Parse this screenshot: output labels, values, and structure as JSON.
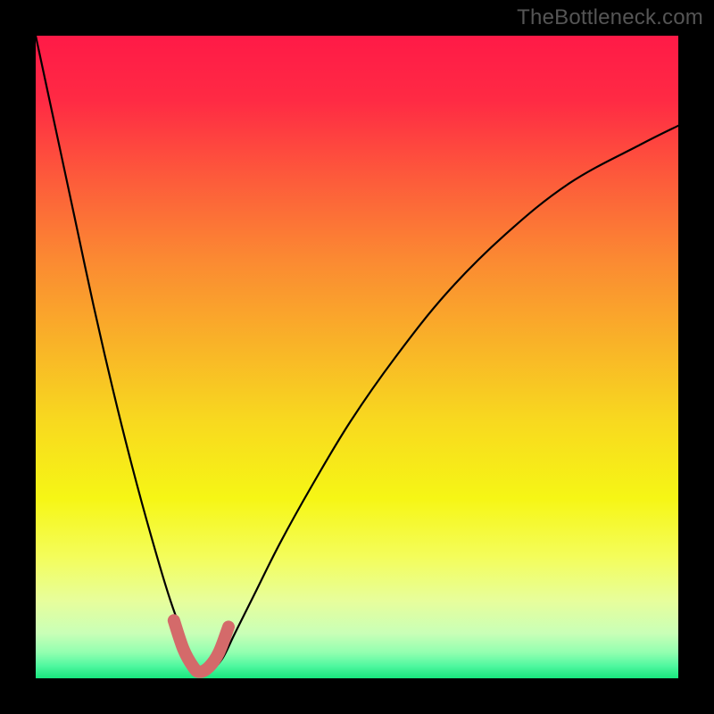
{
  "watermark": "TheBottleneck.com",
  "gradient_stops": [
    {
      "offset": 0,
      "color": "#ff1a47"
    },
    {
      "offset": 10,
      "color": "#ff2a44"
    },
    {
      "offset": 22,
      "color": "#fd5a3b"
    },
    {
      "offset": 35,
      "color": "#fb8a32"
    },
    {
      "offset": 48,
      "color": "#f9b328"
    },
    {
      "offset": 60,
      "color": "#f8d91f"
    },
    {
      "offset": 72,
      "color": "#f6f615"
    },
    {
      "offset": 81,
      "color": "#f4fd5a"
    },
    {
      "offset": 88,
      "color": "#e7fe9c"
    },
    {
      "offset": 93,
      "color": "#c9ffb7"
    },
    {
      "offset": 96,
      "color": "#92ffb0"
    },
    {
      "offset": 98,
      "color": "#52f8a0"
    },
    {
      "offset": 100,
      "color": "#18e77e"
    }
  ],
  "curve_color": "#000000",
  "highlight_color": "#d46a6a",
  "chart_data": {
    "type": "line",
    "title": "",
    "xlabel": "",
    "ylabel": "",
    "xlim": [
      0,
      100
    ],
    "ylim": [
      0,
      100
    ],
    "series": [
      {
        "name": "bottleneck-curve",
        "x": [
          0,
          3,
          6,
          9,
          12,
          15,
          18,
          21,
          24,
          25.5,
          27,
          29,
          31,
          34,
          38,
          43,
          49,
          56,
          64,
          73,
          83,
          94,
          100
        ],
        "y": [
          100,
          86,
          72,
          58,
          45,
          33,
          22,
          12,
          4,
          1,
          1,
          3,
          7,
          13,
          21,
          30,
          40,
          50,
          60,
          69,
          77,
          83,
          86
        ]
      },
      {
        "name": "bottom-highlight",
        "x": [
          21.5,
          23,
          24.5,
          25.5,
          27,
          28.5,
          30
        ],
        "y": [
          9,
          4.5,
          1.8,
          1,
          1.8,
          4,
          8
        ]
      }
    ]
  }
}
